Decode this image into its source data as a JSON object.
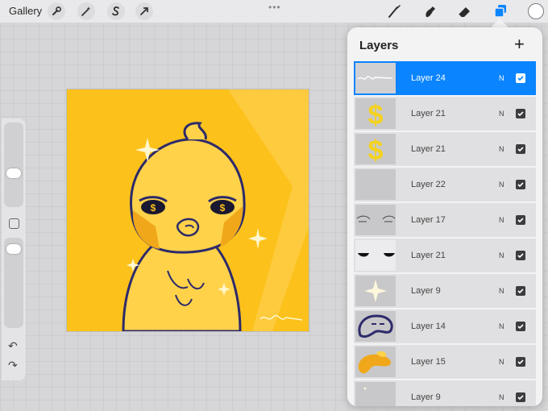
{
  "topbar": {
    "gallery_label": "Gallery",
    "left_tools": [
      "wrench-icon",
      "magic-wand-icon",
      "selection-s-icon",
      "transform-arrow-icon"
    ],
    "right_tools": [
      "brush-icon",
      "smudge-icon",
      "eraser-icon",
      "layers-icon"
    ],
    "active_tool_color": "#0a84ff",
    "current_color": "#ffffff"
  },
  "sidebar": {
    "undo_icon": "undo-icon",
    "redo_icon": "redo-icon"
  },
  "layers_panel": {
    "title": "Layers",
    "add_label": "+",
    "layers": [
      {
        "name": "Layer 24",
        "blend": "N",
        "visible": true,
        "selected": true,
        "thumb": "signature"
      },
      {
        "name": "Layer 21",
        "blend": "N",
        "visible": true,
        "selected": false,
        "thumb": "dollar"
      },
      {
        "name": "Layer 21",
        "blend": "N",
        "visible": true,
        "selected": false,
        "thumb": "dollar"
      },
      {
        "name": "Layer 22",
        "blend": "N",
        "visible": true,
        "selected": false,
        "thumb": "blank"
      },
      {
        "name": "Layer 17",
        "blend": "N",
        "visible": true,
        "selected": false,
        "thumb": "eyelids"
      },
      {
        "name": "Layer 21",
        "blend": "N",
        "visible": true,
        "selected": false,
        "thumb": "eyes"
      },
      {
        "name": "Layer 9",
        "blend": "N",
        "visible": true,
        "selected": false,
        "thumb": "sparkle"
      },
      {
        "name": "Layer 14",
        "blend": "N",
        "visible": true,
        "selected": false,
        "thumb": "mouth"
      },
      {
        "name": "Layer 15",
        "blend": "N",
        "visible": true,
        "selected": false,
        "thumb": "drip"
      },
      {
        "name": "Layer 9",
        "blend": "N",
        "visible": true,
        "selected": false,
        "thumb": "blank"
      }
    ]
  },
  "colors": {
    "canvas_background": "#fcc21b",
    "duck_body": "#ffd24a",
    "outline": "#2d2a6a"
  }
}
